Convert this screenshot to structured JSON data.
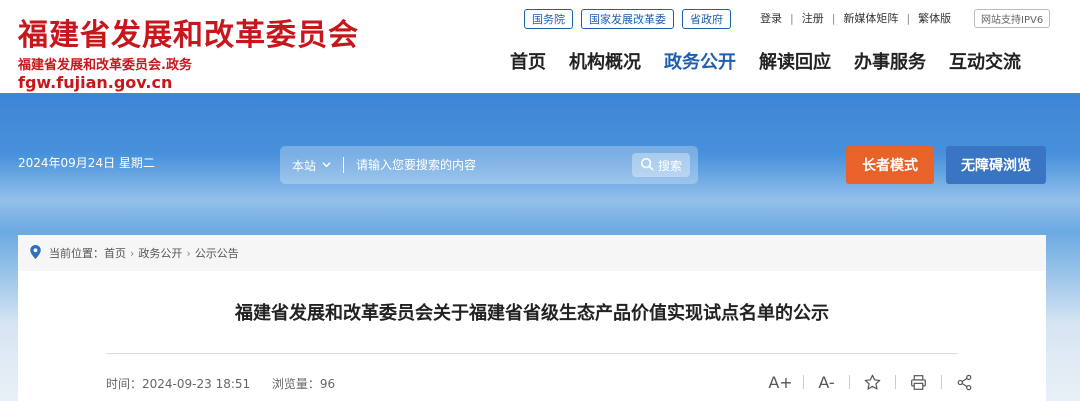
{
  "site": {
    "logo_title": "福建省发展和改革委员会",
    "logo_subtitle": "福建省发展和改革委员会.政务",
    "logo_url": "fgw.fujian.gov.cn"
  },
  "top_links": [
    "国务院",
    "国家发展改革委",
    "省政府"
  ],
  "util_links": [
    "登录",
    "注册",
    "新媒体矩阵",
    "繁体版"
  ],
  "ipv6_label": "网站支持IPV6",
  "nav": {
    "items": [
      "首页",
      "机构概况",
      "政务公开",
      "解读回应",
      "办事服务",
      "互动交流"
    ],
    "active": "政务公开"
  },
  "banner": {
    "date": "2024年09月24日 星期二",
    "search_scope": "本站",
    "search_placeholder": "请输入您要搜索的内容",
    "search_button": "搜索",
    "elder_mode": "长者模式",
    "accessible_browse": "无障碍浏览"
  },
  "breadcrumb": {
    "label": "当前位置：",
    "items": [
      "首页",
      "政务公开",
      "公示公告"
    ]
  },
  "article": {
    "title": "福建省发展和改革委员会关于福建省省级生态产品价值实现试点名单的公示",
    "time_label": "时间：",
    "time_value": "2024-09-23 18:51",
    "views_label": "浏览量：",
    "views_value": "96"
  },
  "tools": {
    "font_increase": "A+",
    "font_decrease": "A-"
  },
  "colors": {
    "brand_red": "#c8161d",
    "nav_active": "#1f5fb0",
    "elder_button": "#e8622a",
    "accessible_button": "#3a75c4"
  }
}
